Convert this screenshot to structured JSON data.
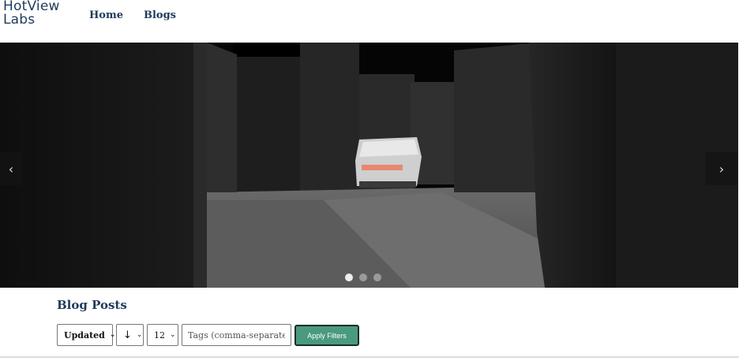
{
  "brand": {
    "line1": "HotView",
    "line2": "Labs"
  },
  "nav": {
    "home": "Home",
    "blogs": "Blogs"
  },
  "carousel": {
    "prev_icon": "‹",
    "next_icon": "›",
    "slide_count": 3,
    "active_slide": 1
  },
  "blog": {
    "title": "Blog Posts",
    "sort_value": "Updated",
    "direction_value": "↓",
    "count_value": "12",
    "tags_placeholder": "Tags (comma-separated)",
    "apply_label": "Apply Filters"
  },
  "colors": {
    "brand": "#1f3b5c",
    "accent": "#4a9a80"
  }
}
